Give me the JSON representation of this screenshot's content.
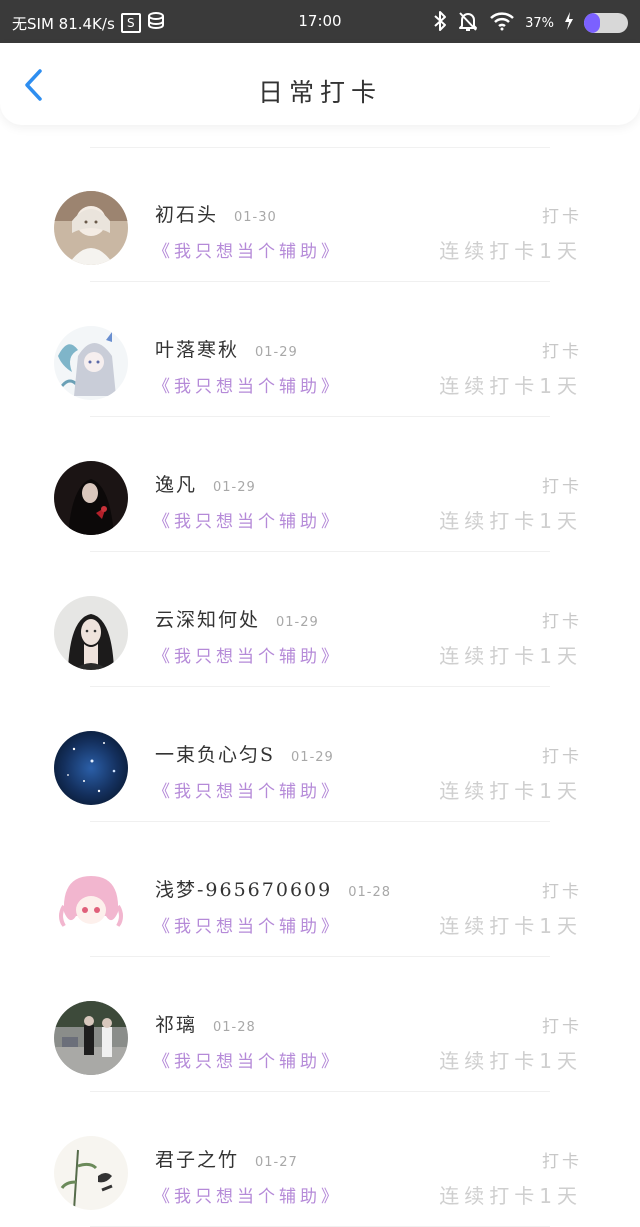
{
  "status_bar": {
    "carrier": "无SIM 81.4K/s",
    "badge_s": "S",
    "time": "17:00",
    "battery_text": "37%",
    "battery_level": 0.37,
    "icons": [
      "data-usage-icon",
      "bluetooth-icon",
      "mute-icon",
      "wifi-icon",
      "charging-icon"
    ]
  },
  "header": {
    "title": "日常打卡",
    "back_icon": "chevron-left-icon"
  },
  "colors": {
    "accent_blue": "#2e8ef0",
    "group_tag_purple": "#b58ad8",
    "muted_gray": "#c8c8c8",
    "battery_purple": "#7b61ff"
  },
  "checkins": [
    {
      "name": "初石头",
      "date": "01-30",
      "group": "《我只想当个辅助》",
      "action": "打卡",
      "streak": "连续打卡1天",
      "avatar": "anime-girl-white-avatar"
    },
    {
      "name": "叶落寒秋",
      "date": "01-29",
      "group": "《我只想当个辅助》",
      "action": "打卡",
      "streak": "连续打卡1天",
      "avatar": "dragon-girl-avatar"
    },
    {
      "name": "逸凡",
      "date": "01-29",
      "group": "《我只想当个辅助》",
      "action": "打卡",
      "streak": "连续打卡1天",
      "avatar": "dark-hair-figure-avatar"
    },
    {
      "name": "云深知何处",
      "date": "01-29",
      "group": "《我只想当个辅助》",
      "action": "打卡",
      "streak": "连续打卡1天",
      "avatar": "girl-portrait-avatar"
    },
    {
      "name": "一束负心匀S",
      "date": "01-29",
      "group": "《我只想当个辅助》",
      "action": "打卡",
      "streak": "连续打卡1天",
      "avatar": "starry-sky-avatar"
    },
    {
      "name": "浅梦-965670609",
      "date": "01-28",
      "group": "《我只想当个辅助》",
      "action": "打卡",
      "streak": "连续打卡1天",
      "avatar": "pink-hair-chibi-avatar"
    },
    {
      "name": "祁璃",
      "date": "01-28",
      "group": "《我只想当个辅助》",
      "action": "打卡",
      "streak": "连续打卡1天",
      "avatar": "street-photo-avatar"
    },
    {
      "name": "君子之竹",
      "date": "01-27",
      "group": "《我只想当个辅助》",
      "action": "打卡",
      "streak": "连续打卡1天",
      "avatar": "bamboo-ink-avatar"
    }
  ]
}
